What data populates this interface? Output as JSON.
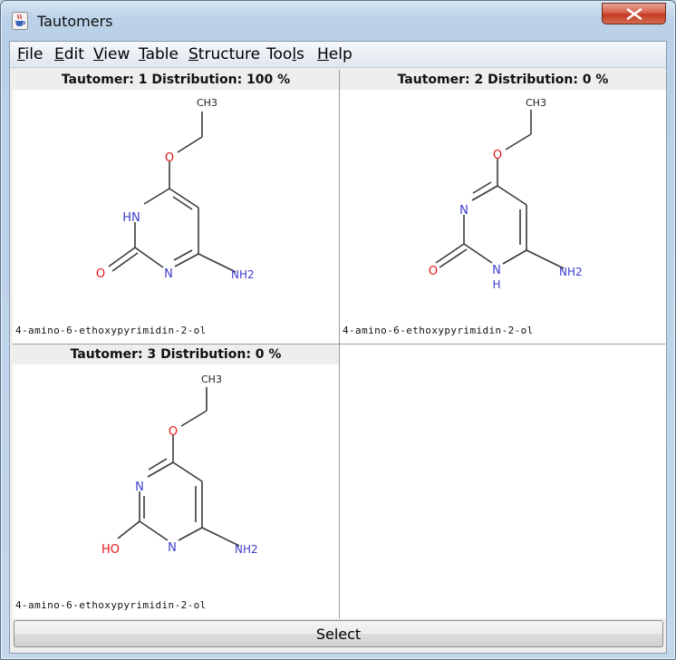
{
  "window": {
    "title": "Tautomers"
  },
  "menu": [
    {
      "label": "File",
      "mnemonic": "F",
      "rest": "ile"
    },
    {
      "label": "Edit",
      "mnemonic": "E",
      "rest": "dit"
    },
    {
      "label": "View",
      "mnemonic": "V",
      "rest": "iew"
    },
    {
      "label": "Table",
      "mnemonic": "T",
      "rest": "able"
    },
    {
      "label": "Structure",
      "mnemonic": "S",
      "rest": "tructure"
    },
    {
      "label": "Tools",
      "pre": "Too",
      "mnemonic": "l",
      "rest": "s"
    },
    {
      "label": "Help",
      "mnemonic": "H",
      "rest": "elp"
    }
  ],
  "tautomers": [
    {
      "header": "Tautomer: 1  Distribution: 100 %",
      "name": "4-amino-6-ethoxypyrimidin-2-ol",
      "labels": {
        "ch3": "CH3",
        "o_ether": "O",
        "n1": "HN",
        "n3": "N",
        "o2": "O",
        "nh2": "NH2"
      }
    },
    {
      "header": "Tautomer: 2  Distribution: 0 %",
      "name": "4-amino-6-ethoxypyrimidin-2-ol",
      "labels": {
        "ch3": "CH3",
        "o_ether": "O",
        "n1": "N",
        "n3": "N",
        "h3": "H",
        "o2": "O",
        "nh2": "NH2"
      }
    },
    {
      "header": "Tautomer: 3  Distribution: 0 %",
      "name": "4-amino-6-ethoxypyrimidin-2-ol",
      "labels": {
        "ch3": "CH3",
        "o_ether": "O",
        "n1": "N",
        "n3": "N",
        "o2": "HO",
        "nh2": "NH2"
      }
    }
  ],
  "buttons": {
    "select": "Select"
  },
  "colors": {
    "oxygen": "#e8151b",
    "nitrogen": "#3b3bcc",
    "bond": "#3a3a3a",
    "close_red": "#c8432b"
  },
  "icons": {
    "app": "java-cup-icon",
    "close": "close-icon"
  }
}
